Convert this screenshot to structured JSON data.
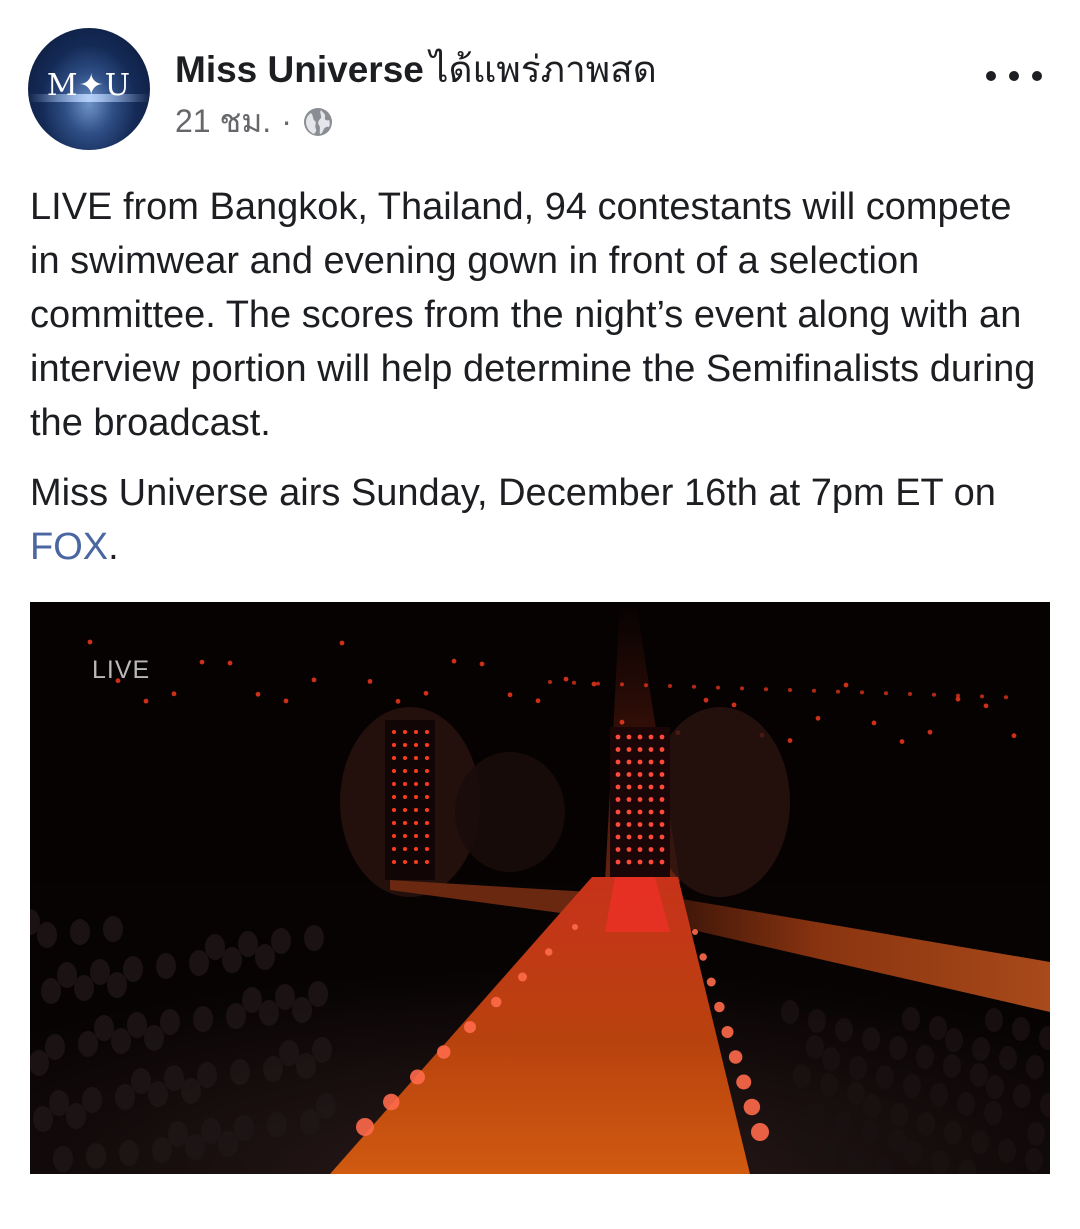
{
  "post": {
    "author": "Miss Universe",
    "action": "ได้แพร่ภาพสด",
    "time": "21 ชม.",
    "separator": "·",
    "audience_icon": "globe-icon",
    "avatar_text": "M✦U",
    "paragraphs": [
      "LIVE from Bangkok, Thailand, 94 contestants will compete in swimwear and evening gown in front of a selection committee. The scores from the night’s event along with an interview portion will help determine the Semifinalists during the broadcast.",
      ""
    ],
    "airs_before": "Miss Universe airs Sunday, December 16th at 7pm ET on ",
    "airs_link": "FOX",
    "airs_after": "."
  },
  "video": {
    "live_badge": "LIVE"
  },
  "colors": {
    "link": "#4b67a1",
    "runway": "#d4461a",
    "stage_lights": "#ff3b1f"
  }
}
